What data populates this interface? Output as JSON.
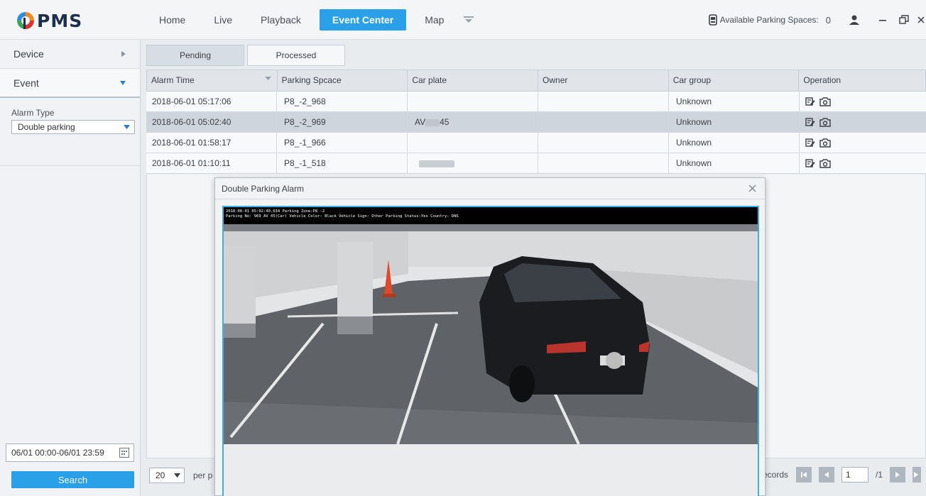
{
  "app": {
    "logo_text": "PMS"
  },
  "nav": {
    "items": [
      "Home",
      "Live",
      "Playback",
      "Event Center",
      "Map"
    ],
    "active": "Event Center"
  },
  "top_right": {
    "parking_label": "Available Parking Spaces:",
    "parking_count": "0"
  },
  "sidebar": {
    "device_label": "Device",
    "event_label": "Event",
    "alarm_type_label": "Alarm Type",
    "alarm_type_value": "Double parking",
    "date_range": "06/01 00:00-06/01 23:59",
    "search_label": "Search"
  },
  "tabs": [
    "Pending",
    "Processed"
  ],
  "table": {
    "columns": [
      "Alarm Time",
      "Parking Spcace",
      "Car plate",
      "Owner",
      "Car group",
      "Operation"
    ],
    "rows": [
      {
        "time": "2018-06-01 05:17:06",
        "space": "P8_-2_968",
        "plate": "",
        "owner": "",
        "group": "Unknown"
      },
      {
        "time": "2018-06-01 05:02:40",
        "space": "P8_-2_969",
        "plate": "AV",
        "plate_tail": "45",
        "owner": "",
        "group": "Unknown"
      },
      {
        "time": "2018-06-01 01:58:17",
        "space": "P8_-1_966",
        "plate": "",
        "owner": "",
        "group": "Unknown"
      },
      {
        "time": "2018-06-01 01:10:11",
        "space": "P8_-1_518",
        "plate": "",
        "owner": "",
        "group": "Unknown"
      }
    ],
    "selected_row": 1
  },
  "footer": {
    "page_size": "20",
    "per_page_fragment": "per p",
    "records_fragment": "ecords",
    "page_input": "1",
    "page_total": "/1"
  },
  "modal": {
    "title": "Double Parking Alarm",
    "caption_line1": "2018-06-01 05:02:40.634  Parking Zone:P8 -2",
    "caption_line2": "Parking No: 969  AV   45(Car)  Vehicle Color: Black  Vehicle Sign: Other  Parking Status:Yes  Country: DNS"
  },
  "colors": {
    "accent": "#2aa0e8",
    "snapshot_border": "#3ab0e8"
  }
}
